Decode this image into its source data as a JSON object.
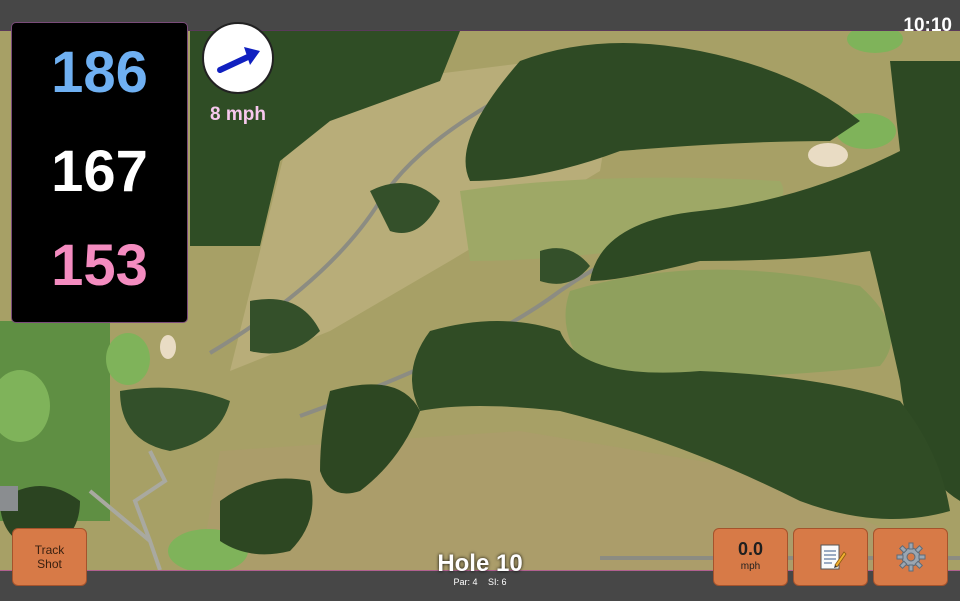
{
  "status": {
    "time": "10:10"
  },
  "distances": {
    "back": "186",
    "middle": "167",
    "front": "153"
  },
  "wind": {
    "speed_text": "8 mph",
    "direction_icon": "wind-arrow-icon"
  },
  "buttons": {
    "track_shot": {
      "line1": "Track",
      "line2": "Shot"
    },
    "speed": {
      "value": "0.0",
      "unit": "mph"
    },
    "notes_icon": "notepad-icon",
    "settings_icon": "gear-icon"
  },
  "hole": {
    "title": "Hole 10",
    "par": "Par: 4",
    "si": "SI: 6"
  },
  "colors": {
    "back": "#6fb0f2",
    "middle": "#ffffff",
    "front": "#f48cc0",
    "wind_text": "#f7c8ee",
    "button": "#d77a47"
  }
}
